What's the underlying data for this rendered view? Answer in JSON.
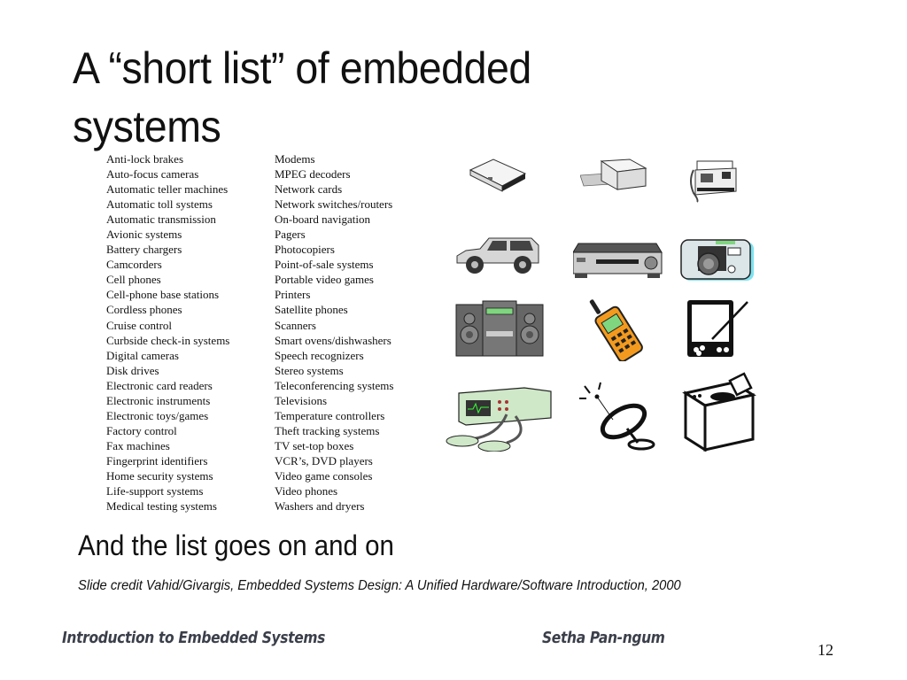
{
  "slide": {
    "title": "A “short list” of embedded systems",
    "list_column_1": [
      "Anti-lock brakes",
      "Auto-focus cameras",
      "Automatic teller machines",
      "Automatic toll systems",
      "Automatic transmission",
      "Avionic systems",
      "Battery chargers",
      "Camcorders",
      "Cell phones",
      "Cell-phone base stations",
      "Cordless phones",
      "Cruise control",
      "Curbside check-in systems",
      "Digital cameras",
      "Disk drives",
      "Electronic card readers",
      "Electronic instruments",
      "Electronic toys/games",
      "Factory control",
      "Fax machines",
      "Fingerprint identifiers",
      "Home security systems",
      "Life-support systems",
      "Medical testing systems"
    ],
    "list_column_2": [
      "Modems",
      "MPEG decoders",
      "Network cards",
      "Network switches/routers",
      "On-board navigation",
      "Pagers",
      "Photocopiers",
      "Point-of-sale systems",
      "Portable video games",
      "Printers",
      "Satellite phones",
      "Scanners",
      "Smart ovens/dishwashers",
      "Speech recognizers",
      "Stereo systems",
      "Teleconferencing systems",
      "Televisions",
      "Temperature controllers",
      "Theft tracking systems",
      "TV set-top boxes",
      "VCR’s, DVD players",
      "Video game consoles",
      "Video phones",
      "Washers and dryers"
    ],
    "clipart_icons": [
      "scanner-icon",
      "printer-icon",
      "fax-machine-icon",
      "suv-car-icon",
      "vcr-icon",
      "digital-camera-icon",
      "stereo-system-icon",
      "cell-phone-icon",
      "pda-icon",
      "defibrillator-icon",
      "satellite-dish-icon",
      "washing-machine-icon"
    ],
    "subtitle": "And the list goes on and on",
    "credit": "Slide credit Vahid/Givargis, Embedded Systems Design: A Unified Hardware/Software Introduction, 2000"
  },
  "footer": {
    "course": "Introduction to Embedded Systems",
    "author": "Setha Pan-ngum",
    "page_number": "12"
  },
  "colors": {
    "footer_text": "#3b3f4a",
    "phone_orange": "#f39a1e",
    "display_green": "#7fd67f",
    "camera_cyan": "#7fe3f0",
    "device_green": "#cfe8c8"
  }
}
